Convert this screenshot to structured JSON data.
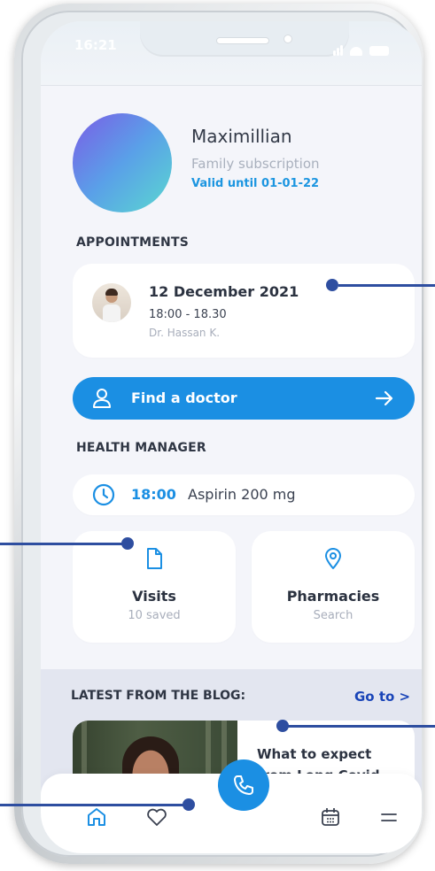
{
  "status": {
    "time": "16:21"
  },
  "profile": {
    "name": "Maximillian",
    "subscription": "Family subscription",
    "valid": "Valid until 01-01-22"
  },
  "appointments": {
    "heading": "APPOINTMENTS",
    "date": "12 December 2021",
    "time": "18:00 - 18.30",
    "doctor": "Dr. Hassan K."
  },
  "find_doctor": {
    "label": "Find a doctor"
  },
  "health_manager": {
    "heading": "HEALTH MANAGER",
    "med_time": "18:00",
    "med_name": "Aspirin 200 mg",
    "tiles": [
      {
        "title": "Visits",
        "sub": "10 saved",
        "icon": "file-icon"
      },
      {
        "title": "Pharmacies",
        "sub": "Search",
        "icon": "location-pin-icon"
      }
    ]
  },
  "blog": {
    "heading": "LATEST FROM THE BLOG:",
    "goto": "Go to >",
    "article_title": "What to expect from Long Covid"
  },
  "tabs": [
    "home-icon",
    "heart-icon",
    "phone-icon",
    "calendar-icon",
    "menu-icon"
  ],
  "colors": {
    "accent": "#1b8fe3",
    "link": "#1a45b8",
    "annotation": "#2e4ea0"
  }
}
